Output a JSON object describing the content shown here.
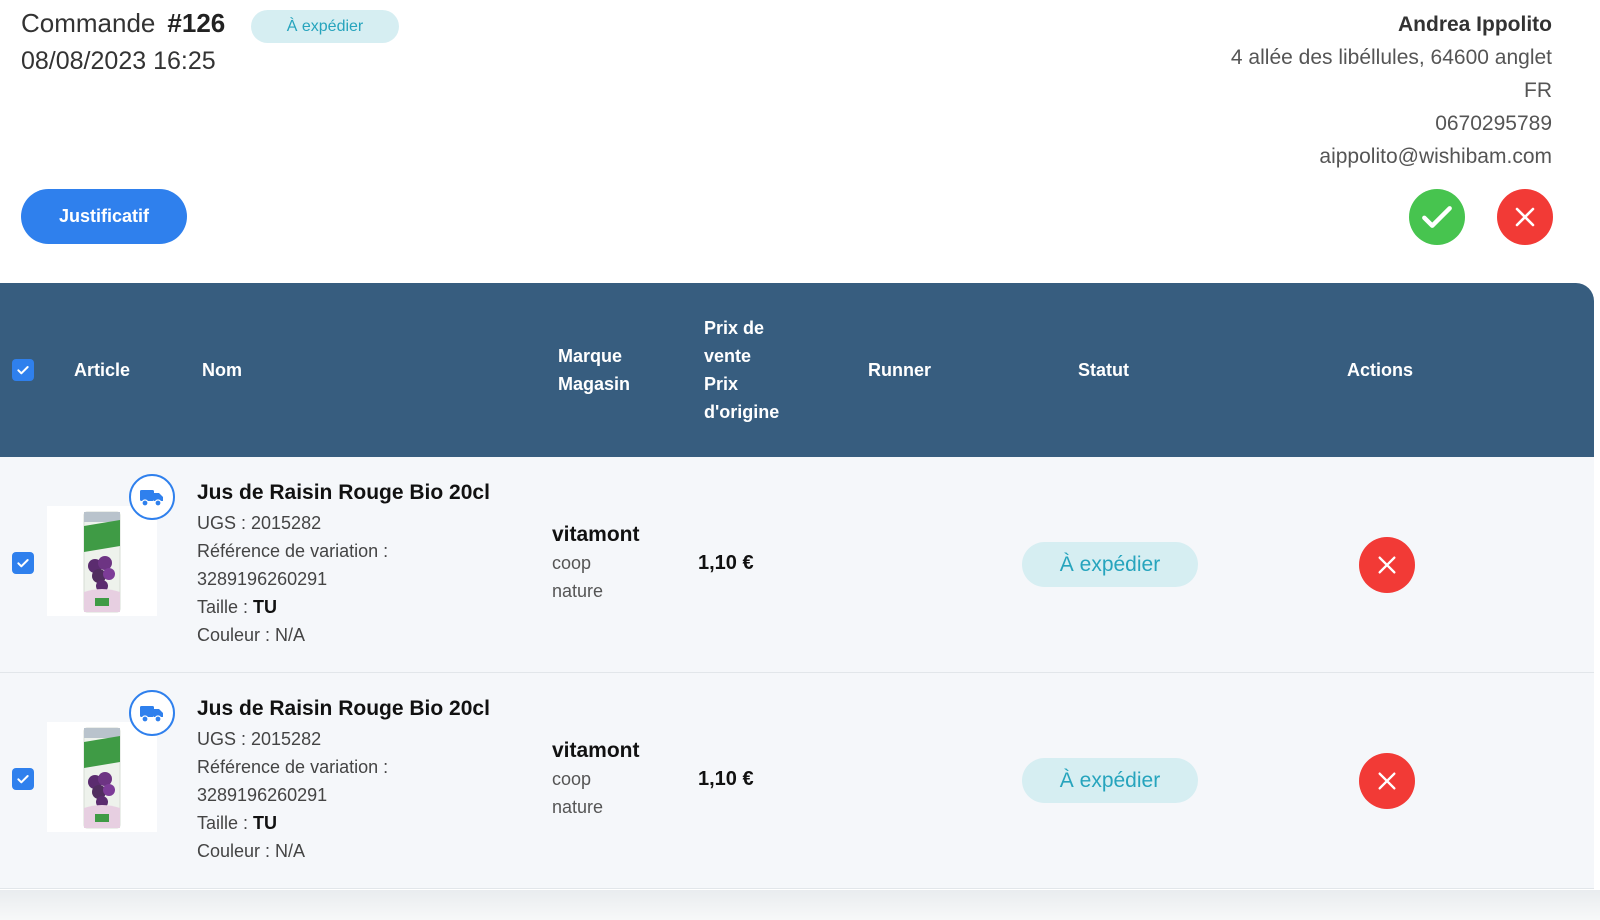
{
  "order": {
    "label": "Commande",
    "number": "#126",
    "status": "À expédier",
    "date": "08/08/2023 16:25"
  },
  "customer": {
    "name": "Andrea Ippolito",
    "address": "4 allée des libéllules, 64600 anglet",
    "country": "FR",
    "phone": "0670295789",
    "email": "aippolito@wishibam.com"
  },
  "actions": {
    "justificatif_label": "Justificatif",
    "validate_icon": "check-icon",
    "reject_icon": "close-icon"
  },
  "table": {
    "headers": {
      "article": "Article",
      "nom": "Nom",
      "marque": "Marque",
      "magasin": "Magasin",
      "prix_vente_1": "Prix de",
      "prix_vente_2": "vente",
      "prix_origine_1": "Prix",
      "prix_origine_2": "d'origine",
      "runner": "Runner",
      "statut": "Statut",
      "actions": "Actions"
    },
    "rows": [
      {
        "name": "Jus de Raisin Rouge Bio 20cl",
        "ugs": "UGS : 2015282",
        "variation_label": "Référence de variation :",
        "variation_value": "3289196260291",
        "size_label": "Taille :",
        "size_value": "TU",
        "color": "Couleur : N/A",
        "brand": "vitamont",
        "store_1": "coop",
        "store_2": "nature",
        "price": "1,10 €",
        "status": "À expédier"
      },
      {
        "name": "Jus de Raisin Rouge Bio 20cl",
        "ugs": "UGS : 2015282",
        "variation_label": "Référence de variation :",
        "variation_value": "3289196260291",
        "size_label": "Taille :",
        "size_value": "TU",
        "color": "Couleur : N/A",
        "brand": "vitamont",
        "store_1": "coop",
        "store_2": "nature",
        "price": "1,10 €",
        "status": "À expédier"
      }
    ]
  },
  "colors": {
    "primary": "#2f80ed",
    "header_bg": "#375d7f",
    "success": "#47c44f",
    "danger": "#f23a36",
    "status_bg": "#d6eef2",
    "status_text": "#26a4bd"
  }
}
